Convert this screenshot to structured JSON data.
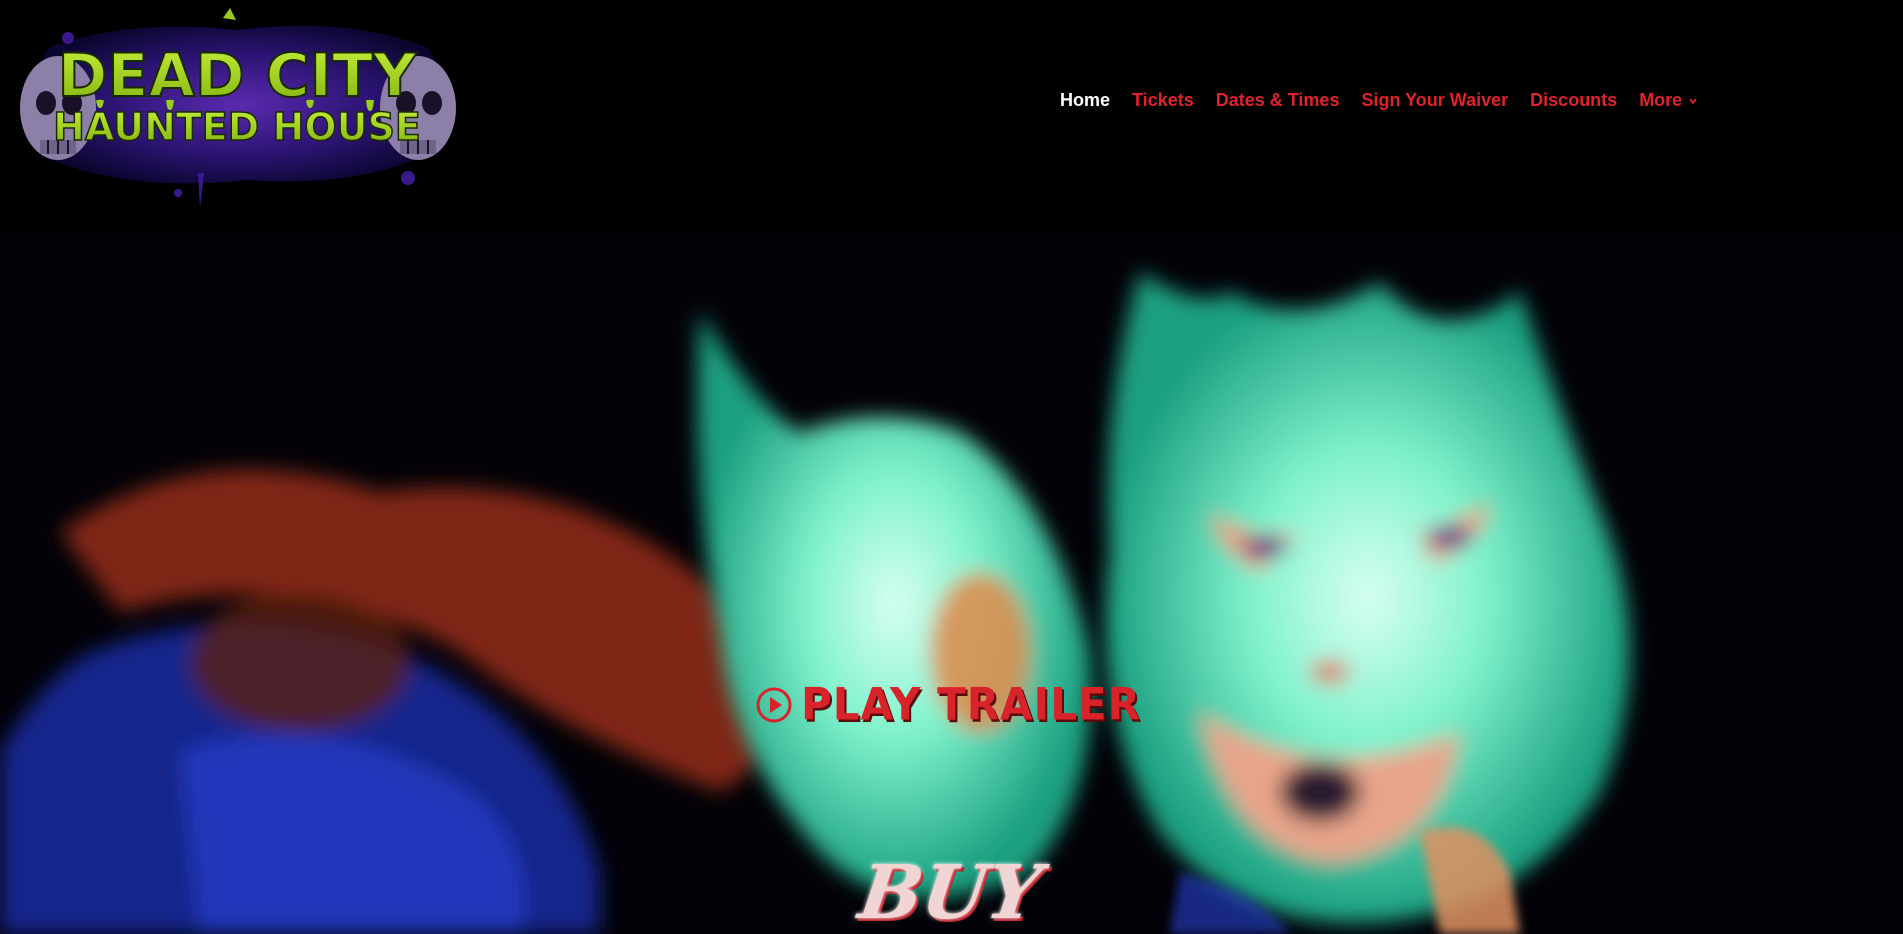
{
  "site": {
    "logo_line1": "DEAD CITY",
    "logo_line2": "HAUNTED HOUSE"
  },
  "nav": {
    "items": [
      {
        "label": "Home",
        "active": true
      },
      {
        "label": "Tickets",
        "active": false
      },
      {
        "label": "Dates & Times",
        "active": false
      },
      {
        "label": "Sign Your Waiver",
        "active": false
      },
      {
        "label": "Discounts",
        "active": false
      },
      {
        "label": "More",
        "active": false,
        "has_dropdown": true
      }
    ]
  },
  "hero": {
    "trailer_label": "PLAY TRAILER",
    "trailer_icon": "play-circle-icon",
    "buy_label": "BUY"
  },
  "colors": {
    "accent": "#e0222a",
    "active": "#ffffff",
    "logo_green": "#9acd1a",
    "logo_purple": "#3a1a8a",
    "ghost_teal": "#4fe0b8"
  }
}
